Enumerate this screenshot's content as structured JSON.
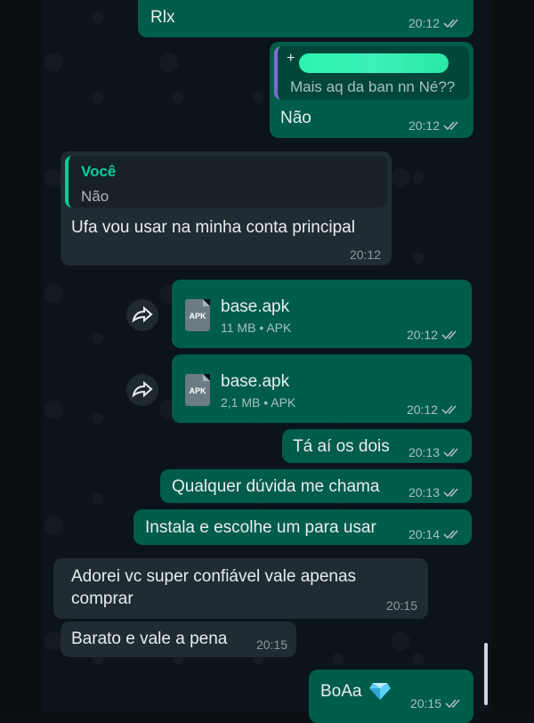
{
  "messages": [
    {
      "text": "Rlx",
      "time": "20:12"
    },
    {
      "quote_text": "Mais aq da ban nn Né??",
      "text": "Não",
      "time": "20:12"
    },
    {
      "quote_author": "Você",
      "quote_text": "Não",
      "text": "Ufa vou usar na minha conta principal",
      "time": "20:12"
    },
    {
      "file_name": "base.apk",
      "file_meta": "11 MB • APK",
      "time": "20:12"
    },
    {
      "file_name": "base.apk",
      "file_meta": "2,1 MB • APK",
      "time": "20:12"
    },
    {
      "text": "Tá aí os dois",
      "time": "20:13"
    },
    {
      "text": "Qualquer dúvida me chama",
      "time": "20:13"
    },
    {
      "text": "Instala e escolhe um para usar",
      "time": "20:14"
    },
    {
      "text_line1": "Adorei vc super confiável vale apenas",
      "text_line2": "comprar",
      "time": "20:15"
    },
    {
      "text": "Barato e vale a pena",
      "time": "20:15"
    },
    {
      "text": "BoAa",
      "time": "20:15"
    }
  ],
  "file_icon_label": "APK",
  "colors": {
    "outgoing_bubble": "#005c4b",
    "incoming_bubble": "#1f2c34",
    "quote_bar_you": "#06cf9c",
    "background": "#0b141a"
  },
  "icons": {
    "forward": "forward-arrow-icon",
    "read": "double-check-icon",
    "emoji": "gem-stone-icon"
  }
}
